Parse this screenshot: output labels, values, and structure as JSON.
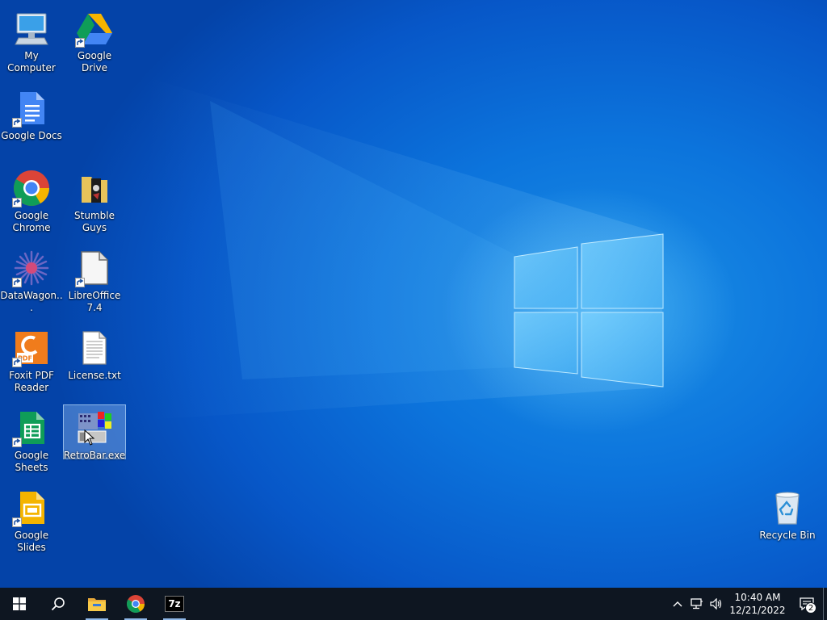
{
  "desktop": {
    "icons": [
      {
        "id": "my-computer",
        "label": "My Computer",
        "icon": "computer-icon",
        "shortcut": false
      },
      {
        "id": "google-drive",
        "label": "Google Drive",
        "icon": "google-drive-icon",
        "shortcut": true
      },
      {
        "id": "google-docs",
        "label": "Google Docs",
        "icon": "google-docs-icon",
        "shortcut": true
      },
      {
        "id": "google-chrome",
        "label": "Google Chrome",
        "icon": "chrome-icon",
        "shortcut": true
      },
      {
        "id": "stumble-guys",
        "label": "Stumble Guys",
        "icon": "stumble-guys-icon",
        "shortcut": false
      },
      {
        "id": "datawagon",
        "label": "DataWagon...",
        "icon": "datawagon-icon",
        "shortcut": true
      },
      {
        "id": "libreoffice",
        "label": "LibreOffice 7.4",
        "icon": "libreoffice-icon",
        "shortcut": true
      },
      {
        "id": "foxit",
        "label": "Foxit PDF Reader",
        "icon": "foxit-pdf-icon",
        "shortcut": true
      },
      {
        "id": "license",
        "label": "License.txt",
        "icon": "text-file-icon",
        "shortcut": false
      },
      {
        "id": "google-sheets",
        "label": "Google Sheets",
        "icon": "google-sheets-icon",
        "shortcut": true
      },
      {
        "id": "retrobar",
        "label": "RetroBar.exe",
        "icon": "retrobar-icon",
        "shortcut": false,
        "selected": true
      },
      {
        "id": "google-slides",
        "label": "Google Slides",
        "icon": "google-slides-icon",
        "shortcut": true
      },
      {
        "id": "recycle-bin",
        "label": "Recycle Bin",
        "icon": "recycle-bin-icon",
        "shortcut": false
      }
    ]
  },
  "taskbar": {
    "start": {
      "icon": "windows-start-icon"
    },
    "search": {
      "icon": "search-icon"
    },
    "pinned": [
      {
        "name": "File Explorer",
        "icon": "file-explorer-icon",
        "running": true
      },
      {
        "name": "Google Chrome",
        "icon": "chrome-icon",
        "running": true
      },
      {
        "name": "7-Zip",
        "icon": "7zip-icon",
        "label": "7z",
        "running": true
      }
    ],
    "tray": {
      "icons": [
        "chevron-up-icon",
        "network-icon",
        "volume-icon"
      ],
      "time": "10:40 AM",
      "date": "12/21/2022",
      "notification_count": "2"
    }
  },
  "colors": {
    "taskbar": "#0e1621",
    "wallpaper": "#0757c8",
    "accent": "#8fb8e8"
  }
}
